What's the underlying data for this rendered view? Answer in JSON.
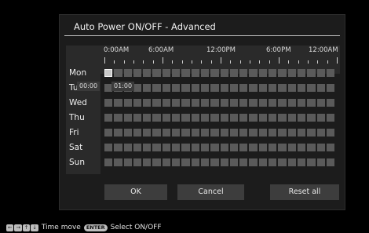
{
  "dialog": {
    "title": "Auto Power ON/OFF - Advanced",
    "scale_labels": [
      "0:00AM",
      "6:00AM",
      "12:00PM",
      "6:00PM",
      "12:00AM"
    ]
  },
  "schedule": {
    "days": [
      {
        "label": "Mon",
        "on": [
          0
        ]
      },
      {
        "label": "Tu",
        "on": []
      },
      {
        "label": "Wed",
        "on": []
      },
      {
        "label": "Thu",
        "on": []
      },
      {
        "label": "Fri",
        "on": []
      },
      {
        "label": "Sat",
        "on": []
      },
      {
        "label": "Sun",
        "on": []
      }
    ],
    "slots_per_day": 24
  },
  "tooltip": {
    "start": "00:00",
    "end": "01:00"
  },
  "buttons": {
    "ok": "OK",
    "cancel": "Cancel",
    "reset_all": "Reset all"
  },
  "status_bar": {
    "move_hint": "Time move",
    "enter_key": "ENTER",
    "select_hint": "Select ON/OFF",
    "arrow_icons": [
      "←",
      "→",
      "↑",
      "↓"
    ]
  }
}
